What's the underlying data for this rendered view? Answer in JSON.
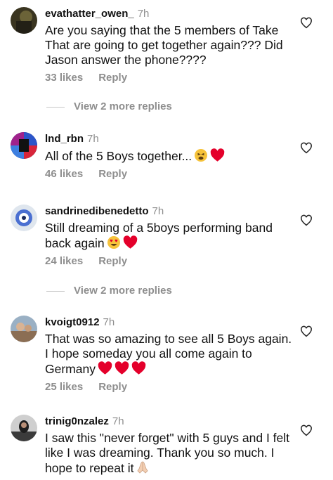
{
  "comments": [
    {
      "username": "evathatter_owen_",
      "time": "7h",
      "text": "Are you saying that the 5 members of Take That are going to get together again??? Did Jason answer the phone????",
      "emojis": [],
      "likes": "33 likes",
      "reply": "Reply",
      "view_replies": "View 2 more replies"
    },
    {
      "username": "lnd_rbn",
      "time": "7h",
      "text": "All of the 5 Boys together...",
      "emojis": [
        "tired-face-emoji",
        "red-heart-emoji"
      ],
      "likes": "46 likes",
      "reply": "Reply"
    },
    {
      "username": "sandrinedibenedetto",
      "time": "7h",
      "text": "Still dreaming of a 5boys performing band back again",
      "emojis": [
        "heart-eyes-emoji",
        "red-heart-emoji"
      ],
      "likes": "24 likes",
      "reply": "Reply",
      "view_replies": "View 2 more replies"
    },
    {
      "username": "kvoigt0912",
      "time": "7h",
      "text": "That was so amazing to see all 5 Boys again. I hope someday you all  come again to Germany",
      "emojis": [
        "red-heart-emoji",
        "red-heart-emoji",
        "red-heart-emoji"
      ],
      "likes": "25 likes",
      "reply": "Reply"
    },
    {
      "username": "trinig0nzalez",
      "time": "7h",
      "text": "I saw this \"never forget\" with 5 guys and I felt like I was dreaming. Thank you so much. I hope to repeat it",
      "emojis": [
        "folded-hands-emoji"
      ]
    }
  ],
  "colors": {
    "text": "#111111",
    "secondary": "#8e8e8e",
    "background": "#ffffff",
    "heart": "#e4002b"
  }
}
